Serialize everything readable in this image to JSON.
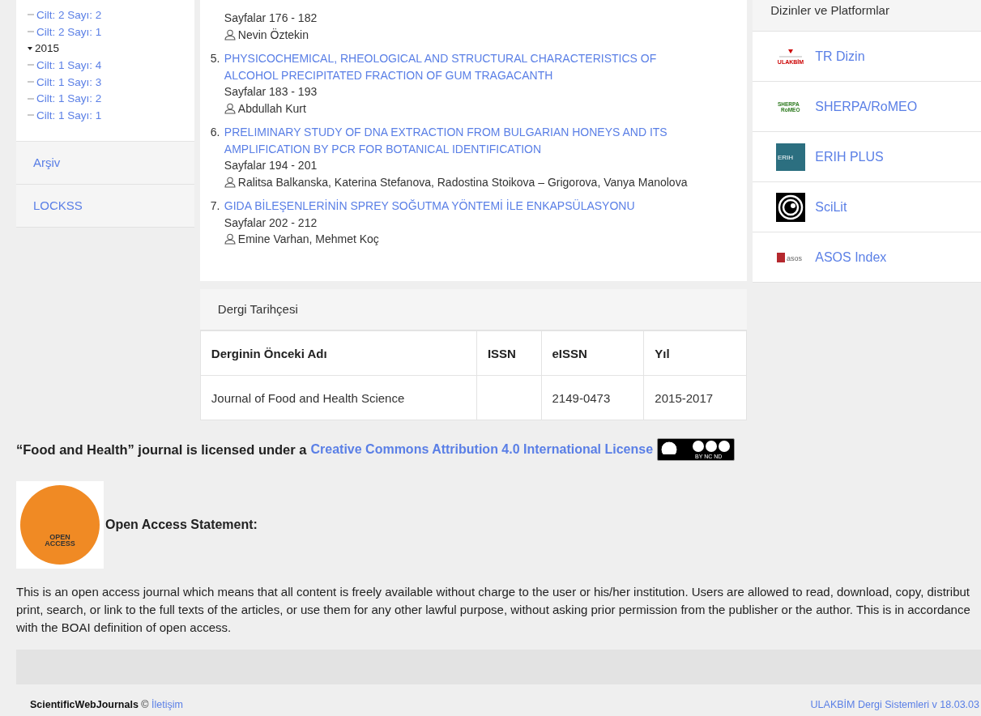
{
  "sidebar": {
    "tree": [
      {
        "label": "Cilt: 2 Sayı: 2"
      },
      {
        "label": "Cilt: 2 Sayı: 1"
      },
      {
        "label": "2015",
        "expanded": true,
        "children": [
          {
            "label": "Cilt: 1 Sayı: 4"
          },
          {
            "label": "Cilt: 1 Sayı: 3"
          },
          {
            "label": "Cilt: 1 Sayı: 2"
          },
          {
            "label": "Cilt: 1 Sayı: 1"
          }
        ]
      }
    ],
    "links": [
      "Arşiv",
      "LOCKSS"
    ]
  },
  "articles": [
    {
      "pages": "Sayfalar 176 - 182",
      "authors": "Nevin Öztekin"
    },
    {
      "number": "5.",
      "title": "PHYSICOCHEMICAL, RHEOLOGICAL AND STRUCTURAL CHARACTERISTICS OF ALCOHOL PRECIPITATED FRACTION OF GUM TRAGACANTH",
      "pages": "Sayfalar 183 - 193",
      "authors": "Abdullah Kurt"
    },
    {
      "number": "6.",
      "title": "PRELIMINARY STUDY OF DNA EXTRACTION FROM BULGARIAN HONEYS AND ITS AMPLIFICATION BY PCR FOR BOTANICAL IDENTIFICATION",
      "pages": "Sayfalar 194 - 201",
      "authors": "Ralitsa Balkanska, Katerina Stefanova, Radostina Stoikova – Grigorova, Vanya Manolova"
    },
    {
      "number": "7.",
      "title": "GIDA BİLEŞENLERİNİN SPREY SOĞUTMA YÖNTEMİ İLE ENKAPSÜLASYONU",
      "pages": "Sayfalar 202 - 212",
      "authors": "Emine Varhan, Mehmet Koç"
    }
  ],
  "history": {
    "title": "Dergi Tarihçesi",
    "columns": [
      "Derginin Önceki Adı",
      "ISSN",
      "eISSN",
      "Yıl"
    ],
    "rows": [
      [
        "Journal of Food and Health Science",
        "",
        "2149-0473",
        "2015-2017"
      ]
    ]
  },
  "indexes": {
    "title": "Dizinler ve Platformlar",
    "items": [
      {
        "kind": "ulakbim",
        "label": "TR Dizin",
        "logo_text": "ULAKBİM"
      },
      {
        "kind": "sherpa",
        "label": "SHERPA/RoMEO",
        "logo_text": "SHERPA RoMEO"
      },
      {
        "kind": "erih",
        "label": "ERIH PLUS",
        "logo_text": "ERIH"
      },
      {
        "kind": "scilit",
        "label": "SciLit"
      },
      {
        "kind": "asos",
        "label": "ASOS Index",
        "logo_text": "asos"
      }
    ]
  },
  "license": {
    "lead": "“Food and Health” journal is licensed under a",
    "link": "Creative Commons Attribution 4.0 International License",
    "badge_text": "BY NC ND"
  },
  "open_access": {
    "logo_text": "OPEN ACCESS",
    "heading": "Open Access Statement:",
    "lines": [
      "This is an open access journal which means that all content is freely available without charge to the user or his/her institution. Users are allowed to read, download, copy, distribut",
      "print, search, or link to the full texts of the articles, or use them for any other lawful purpose, without asking prior permission from the publisher or the author. This is in accordance",
      "with the BOAI definition of open access."
    ]
  },
  "footer": {
    "brand": "ScientificWebJournals",
    "copyright": "©",
    "contact": "İletişim",
    "version": "ULAKBİM Dergi Sistemleri v 18.03.03"
  }
}
